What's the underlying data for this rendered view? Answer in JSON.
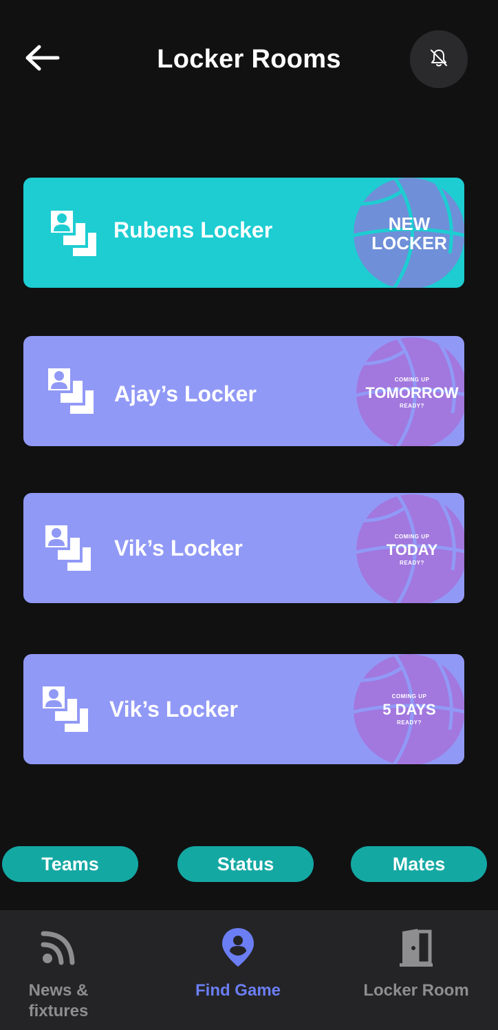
{
  "header": {
    "title": "Locker Rooms",
    "back_icon": "arrow-left-icon",
    "bell_icon": "bell-off-icon"
  },
  "lockers": [
    {
      "name": "Rubens Locker",
      "status_big": "NEW LOCKER",
      "status_line1": "NEW",
      "status_line2": "LOCKER",
      "color": "#1dcdd2",
      "ball_color": "#6f8fd8"
    },
    {
      "name": "Ajay’s Locker",
      "top": "COMING UP",
      "big": "TOMORROW",
      "bottom": "READY?",
      "color": "#9199f6",
      "ball_color": "#a277de"
    },
    {
      "name": "Vik’s Locker",
      "top": "COMING UP",
      "big": "TODAY",
      "bottom": "READY?",
      "color": "#9199f6",
      "ball_color": "#a277de"
    },
    {
      "name": "Vik’s Locker",
      "top": "COMING UP",
      "big": "5 DAYS",
      "bottom": "READY?",
      "color": "#9199f6",
      "ball_color": "#a277de"
    }
  ],
  "pills": [
    "Teams",
    "Status",
    "Mates"
  ],
  "bottom_nav": [
    {
      "label": "News & fixtures",
      "icon": "rss-feed-icon",
      "active": false
    },
    {
      "label": "Find Game",
      "icon": "location-pin-user-icon",
      "active": true
    },
    {
      "label": "Locker Room",
      "icon": "door-icon",
      "active": false
    }
  ],
  "colors": {
    "background": "#111112",
    "teal": "#1dcdd2",
    "violet": "#9199f6",
    "pill": "#14a8a3",
    "nav_active": "#6b7ef4",
    "nav_inactive": "#8e8e90"
  }
}
